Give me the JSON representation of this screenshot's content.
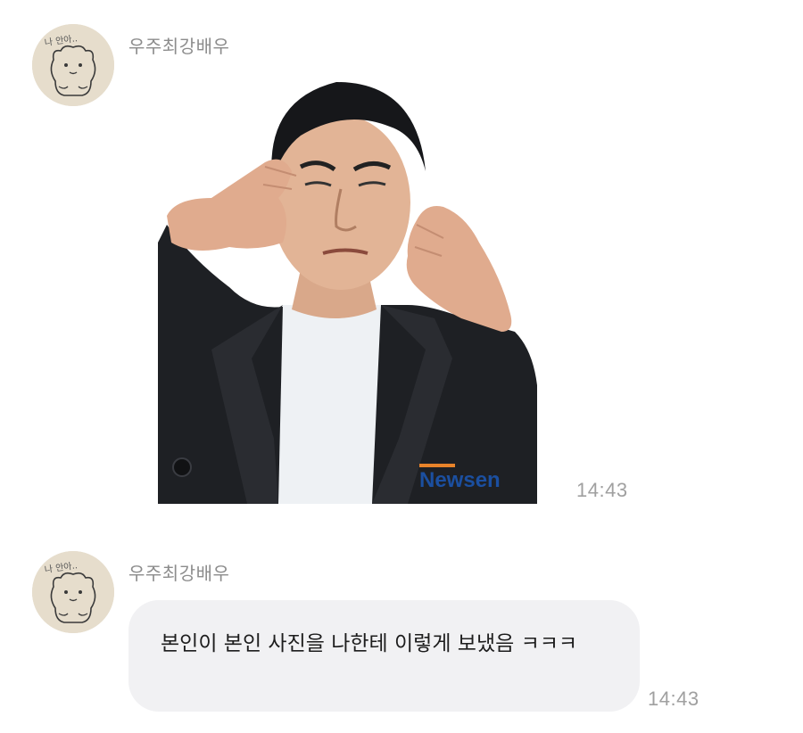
{
  "messages": [
    {
      "sender": "우주최강배우",
      "avatar_icon": "hamster-drawing-avatar",
      "avatar_caption": "나 안아..",
      "type": "image",
      "image_description": "photo of a man in a black coat and white t-shirt pressing his cheeks with both hands",
      "watermark": "Newsen",
      "time": "14:43"
    },
    {
      "sender": "우주최강배우",
      "avatar_icon": "hamster-drawing-avatar",
      "avatar_caption": "나 안아..",
      "type": "text",
      "text": "본인이 본인 사진을 나한테 이렇게 보냈음 ㅋㅋㅋ",
      "time": "14:43"
    }
  ],
  "colors": {
    "bubble_background": "#f1f1f3",
    "sender_name": "#8c8c8c",
    "timestamp": "#a0a0a0",
    "avatar_background": "#e4dccb"
  }
}
